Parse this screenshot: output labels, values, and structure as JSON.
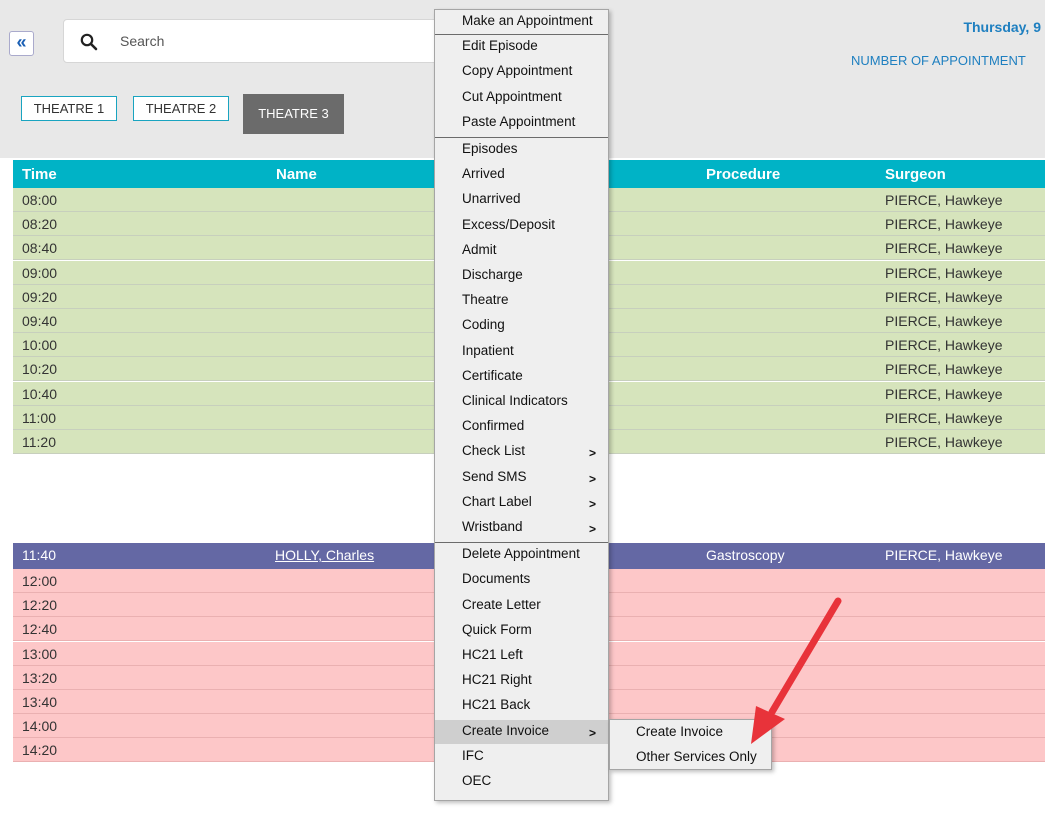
{
  "header": {
    "search_placeholder": "Search",
    "date": "Thursday, 9",
    "num_appointments_label": "NUMBER OF APPOINTMENT",
    "tabs": [
      "THEATRE 1",
      "THEATRE 2",
      "THEATRE 3"
    ],
    "active_tab": "THEATRE 3"
  },
  "grid": {
    "columns": [
      "Time",
      "Name",
      "Procedure",
      "Surgeon"
    ],
    "rows": [
      {
        "time": "08:00",
        "name": "",
        "procedure": "",
        "surgeon": "PIERCE, Hawkeye"
      },
      {
        "time": "08:20",
        "name": "",
        "procedure": "",
        "surgeon": "PIERCE, Hawkeye"
      },
      {
        "time": "08:40",
        "name": "",
        "procedure": "",
        "surgeon": "PIERCE, Hawkeye"
      },
      {
        "time": "09:00",
        "name": "",
        "procedure": "",
        "surgeon": "PIERCE, Hawkeye"
      },
      {
        "time": "09:20",
        "name": "",
        "procedure": "",
        "surgeon": "PIERCE, Hawkeye"
      },
      {
        "time": "09:40",
        "name": "",
        "procedure": "",
        "surgeon": "PIERCE, Hawkeye"
      },
      {
        "time": "10:00",
        "name": "",
        "procedure": "",
        "surgeon": "PIERCE, Hawkeye"
      },
      {
        "time": "10:20",
        "name": "",
        "procedure": "",
        "surgeon": "PIERCE, Hawkeye"
      },
      {
        "time": "10:40",
        "name": "",
        "procedure": "",
        "surgeon": "PIERCE, Hawkeye"
      },
      {
        "time": "11:00",
        "name": "",
        "procedure": "",
        "surgeon": "PIERCE, Hawkeye"
      },
      {
        "time": "11:20",
        "name": "",
        "procedure": "",
        "surgeon": "PIERCE, Hawkeye"
      },
      {
        "time": "11:40",
        "name": "HOLLY, Charles",
        "procedure": "Gastroscopy",
        "surgeon": "PIERCE, Hawkeye"
      },
      {
        "time": "12:00",
        "name": "",
        "procedure": "",
        "surgeon": ""
      },
      {
        "time": "12:20",
        "name": "",
        "procedure": "",
        "surgeon": ""
      },
      {
        "time": "12:40",
        "name": "",
        "procedure": "",
        "surgeon": ""
      },
      {
        "time": "13:00",
        "name": "",
        "procedure": "",
        "surgeon": ""
      },
      {
        "time": "13:20",
        "name": "",
        "procedure": "",
        "surgeon": ""
      },
      {
        "time": "13:40",
        "name": "",
        "procedure": "",
        "surgeon": ""
      },
      {
        "time": "14:00",
        "name": "",
        "procedure": "",
        "surgeon": ""
      },
      {
        "time": "14:20",
        "name": "",
        "procedure": "",
        "surgeon": ""
      }
    ]
  },
  "context_menu": {
    "items": [
      "Make an Appointment",
      "Edit Episode",
      "Copy Appointment",
      "Cut Appointment",
      "Paste Appointment",
      "Episodes",
      "Arrived",
      "Unarrived",
      "Excess/Deposit",
      "Admit",
      "Discharge",
      "Theatre",
      "Coding",
      "Inpatient",
      "Certificate",
      "Clinical Indicators",
      "Confirmed",
      "Check List",
      "Send SMS",
      "Chart Label",
      "Wristband",
      "Delete Appointment",
      "Documents",
      "Create Letter",
      "Quick Form",
      "HC21 Left",
      "HC21 Right",
      "HC21 Back",
      "Create Invoice",
      "IFC",
      "OEC"
    ],
    "submenu_marker": ">",
    "highlighted": "Create Invoice"
  },
  "submenu": {
    "items": [
      "Create Invoice",
      "Other Services Only"
    ]
  },
  "colors": {
    "header_bar": "#00b3c6",
    "available_slot": "#d6e4bc",
    "unavailable_slot": "#fdc7c8",
    "selected_row": "#6468a4",
    "annotation_arrow": "#e8333a"
  }
}
